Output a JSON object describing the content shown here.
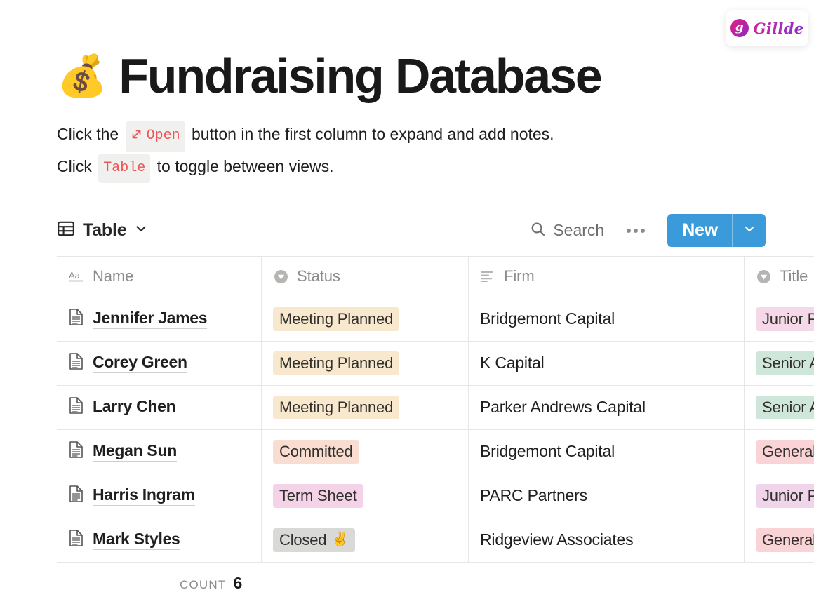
{
  "brand": {
    "mark_letter": "g",
    "name": "Gillde",
    "gradient_start": "#e0218a",
    "gradient_end": "#8b2bc9"
  },
  "header": {
    "emoji": "💰",
    "title": "Fundraising Database"
  },
  "intro": {
    "line1_prefix": "Click the",
    "chip_open": "Open",
    "line1_suffix": "button in the first column to expand and add notes.",
    "line2_prefix": "Click",
    "chip_table": "Table",
    "line2_suffix": "to toggle between views.",
    "chip_color": "#eb5757",
    "chip_bg": "#f0f0ef"
  },
  "toolbar": {
    "view_label": "Table",
    "search_label": "Search",
    "more_label": "…",
    "new_label": "New",
    "new_button_color": "#3b9ad9"
  },
  "table": {
    "columns": [
      {
        "label": "Name",
        "icon": "aa-text-icon"
      },
      {
        "label": "Status",
        "icon": "select-circle-icon"
      },
      {
        "label": "Firm",
        "icon": "text-lines-icon"
      },
      {
        "label": "Title",
        "icon": "select-circle-icon"
      }
    ],
    "rows": [
      {
        "name": "Jennifer James",
        "status": {
          "text": "Meeting Planned",
          "emoji": "",
          "bg": "#f8e8cd"
        },
        "firm": "Bridgemont Capital",
        "title": {
          "text": "Junior P",
          "bg": "#f5d9e8"
        }
      },
      {
        "name": "Corey Green",
        "status": {
          "text": "Meeting Planned",
          "emoji": "",
          "bg": "#f8e8cd"
        },
        "firm": "K Capital",
        "title": {
          "text": "Senior A",
          "bg": "#cfe6da"
        }
      },
      {
        "name": "Larry Chen",
        "status": {
          "text": "Meeting Planned",
          "emoji": "",
          "bg": "#f8e8cd"
        },
        "firm": "Parker Andrews Capital",
        "title": {
          "text": "Senior A",
          "bg": "#cfe6da"
        }
      },
      {
        "name": "Megan Sun",
        "status": {
          "text": "Committed",
          "emoji": "",
          "bg": "#f9ddd1"
        },
        "firm": "Bridgemont Capital",
        "title": {
          "text": "General",
          "bg": "#fad3d7"
        }
      },
      {
        "name": "Harris Ingram",
        "status": {
          "text": "Term Sheet",
          "emoji": "",
          "bg": "#f4d2e7"
        },
        "firm": "PARC Partners",
        "title": {
          "text": "Junior P",
          "bg": "#f0d5ea"
        }
      },
      {
        "name": "Mark Styles",
        "status": {
          "text": "Closed",
          "emoji": "✌️",
          "bg": "#d9d9d7"
        },
        "firm": "Ridgeview Associates",
        "title": {
          "text": "General",
          "bg": "#fad3d7"
        }
      }
    ],
    "footer": {
      "count_label": "Count",
      "count_value": "6"
    }
  }
}
